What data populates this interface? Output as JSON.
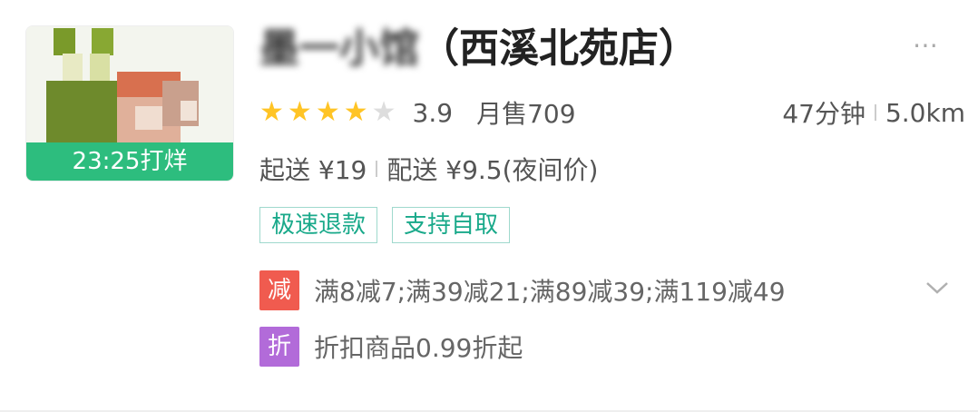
{
  "store": {
    "name_blurred": "墨一小馆",
    "name_suffix": "（西溪北苑店）",
    "badge": "23:25打烊",
    "more_icon": "⋯"
  },
  "rating": {
    "stars": 4,
    "max": 5,
    "score": "3.9",
    "monthly_sales": "月售709"
  },
  "delivery": {
    "time": "47分钟",
    "distance": "5.0km"
  },
  "fees": {
    "min_order": "起送 ¥19",
    "delivery_fee": "配送 ¥9.5(夜间价)"
  },
  "tags": [
    "极速退款",
    "支持自取"
  ],
  "promotions": [
    {
      "icon_text": "减",
      "icon_color": "#f05b4f",
      "text": "满8减7;满39减21;满89减39;满119减49"
    },
    {
      "icon_text": "折",
      "icon_color": "#b26bd9",
      "text": "折扣商品0.99折起"
    }
  ],
  "colors": {
    "badge_green": "#2dbd7e",
    "star": "#ffc425",
    "tag_border": "#9fd9cd",
    "tag_text": "#19a98a"
  }
}
